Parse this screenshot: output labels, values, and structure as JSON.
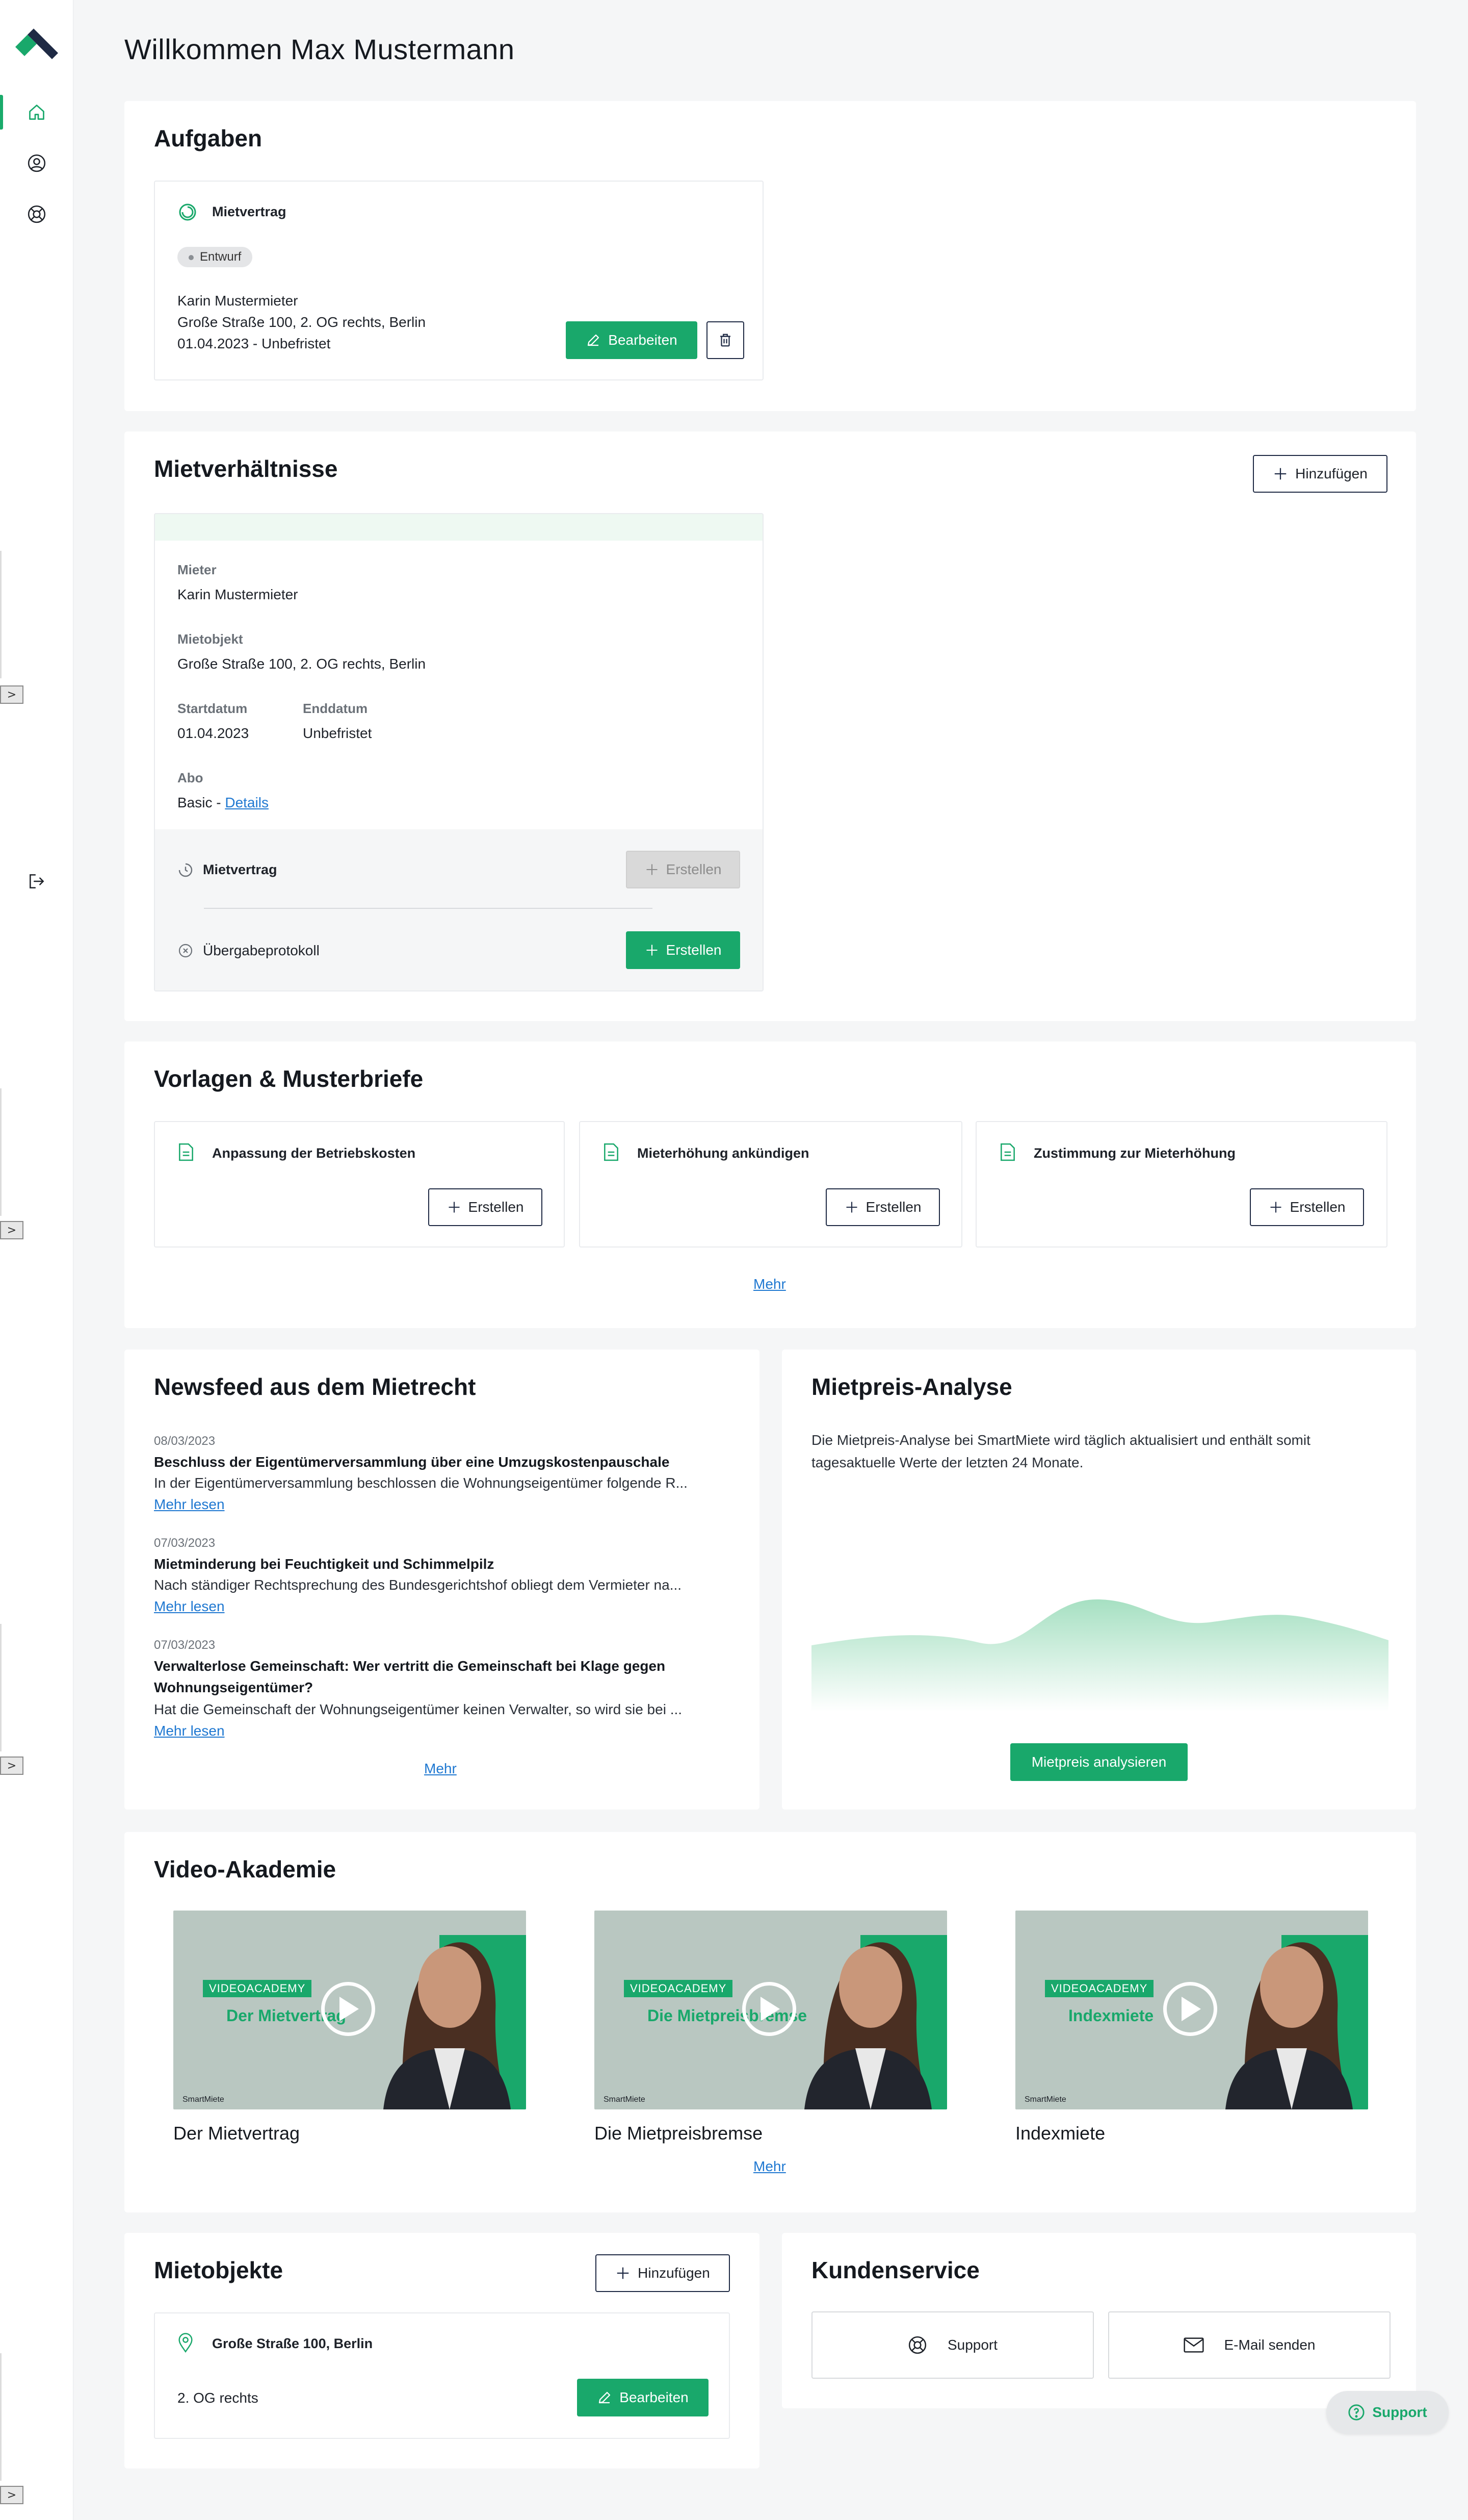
{
  "colors": {
    "brand_green": "#19a86b",
    "brand_dark": "#1f2a44",
    "link": "#1f78d1"
  },
  "sidebar": {
    "items": [
      {
        "name": "home",
        "icon": "home-icon"
      },
      {
        "name": "account",
        "icon": "user-circle-icon"
      },
      {
        "name": "help",
        "icon": "lifebuoy-icon"
      },
      {
        "name": "logout",
        "icon": "logout-icon"
      }
    ],
    "tab_glyph": ">"
  },
  "page": {
    "title": "Willkommen Max Mustermann"
  },
  "aufgaben": {
    "title": "Aufgaben",
    "task": {
      "name": "Mietvertrag",
      "status": "Entwurf",
      "tenant": "Karin Mustermieter",
      "address": "Große Straße 100, 2. OG rechts, Berlin",
      "period": "01.04.2023 - Unbefristet",
      "edit_label": "Bearbeiten"
    }
  },
  "mietverhaeltnisse": {
    "title": "Mietverhältnisse",
    "add_label": "Hinzufügen",
    "contract": {
      "tenant_label": "Mieter",
      "tenant_value": "Karin Mustermieter",
      "object_label": "Mietobjekt",
      "object_value": "Große Straße 100, 2. OG rechts, Berlin",
      "start_label": "Startdatum",
      "start_value": "01.04.2023",
      "end_label": "Enddatum",
      "end_value": "Unbefristet",
      "abo_label": "Abo",
      "abo_value": "Basic - ",
      "abo_link": "Details",
      "doc1_name": "Mietvertrag",
      "doc1_action": "Erstellen",
      "doc2_name": "Übergabeprotokoll",
      "doc2_action": "Erstellen"
    }
  },
  "vorlagen": {
    "title": "Vorlagen & Musterbriefe",
    "items": [
      {
        "name": "Anpassung der Betriebskosten",
        "action": "Erstellen"
      },
      {
        "name": "Mieterhöhung ankündigen",
        "action": "Erstellen"
      },
      {
        "name": "Zustimmung zur Mieterhöhung",
        "action": "Erstellen"
      }
    ],
    "more": "Mehr"
  },
  "newsfeed": {
    "title": "Newsfeed aus dem Mietrecht",
    "items": [
      {
        "date": "08/03/2023",
        "title": "Beschluss der Eigentümerversammlung über eine Umzugskostenpauschale",
        "text": "In der Eigentümerversammlung beschlossen die Wohnungseigentümer folgende R...",
        "more": "Mehr lesen"
      },
      {
        "date": "07/03/2023",
        "title": "Mietminderung bei Feuchtigkeit und Schimmelpilz",
        "text": "Nach ständiger Rechtsprechung des Bundesgerichtshof obliegt dem Vermieter na...",
        "more": "Mehr lesen"
      },
      {
        "date": "07/03/2023",
        "title": "Verwalterlose Gemeinschaft: Wer vertritt die Gemeinschaft bei Klage gegen Wohnungseigentümer?",
        "text": "Hat die Gemeinschaft der Wohnungseigentümer keinen Verwalter, so wird sie bei ...",
        "more": "Mehr lesen"
      }
    ],
    "more": "Mehr"
  },
  "mietpreis": {
    "title": "Mietpreis-Analyse",
    "description": "Die Mietpreis-Analyse bei SmartMiete wird täglich aktualisiert und enthält somit tagesaktuelle Werte der letzten 24 Monate.",
    "action": "Mietpreis analysieren"
  },
  "video_akademie": {
    "title": "Video-Akademie",
    "tag": "VIDEOACADEMY",
    "brand": "SmartMiete",
    "videos": [
      {
        "thumb_title": "Der Mietvertrag",
        "caption": "Der Mietvertrag"
      },
      {
        "thumb_title": "Die Mietpreisbremse",
        "caption": "Die Mietpreisbremse"
      },
      {
        "thumb_title": "Indexmiete",
        "caption": "Indexmiete"
      }
    ],
    "more": "Mehr"
  },
  "mietobjekte": {
    "title": "Mietobjekte",
    "add_label": "Hinzufügen",
    "object": {
      "name": "Große Straße 100, Berlin",
      "unit": "2. OG rechts",
      "edit_label": "Bearbeiten"
    }
  },
  "kundenservice": {
    "title": "Kundenservice",
    "support_label": "Support",
    "email_label": "E-Mail senden"
  },
  "floating_support": {
    "label": "Support"
  }
}
